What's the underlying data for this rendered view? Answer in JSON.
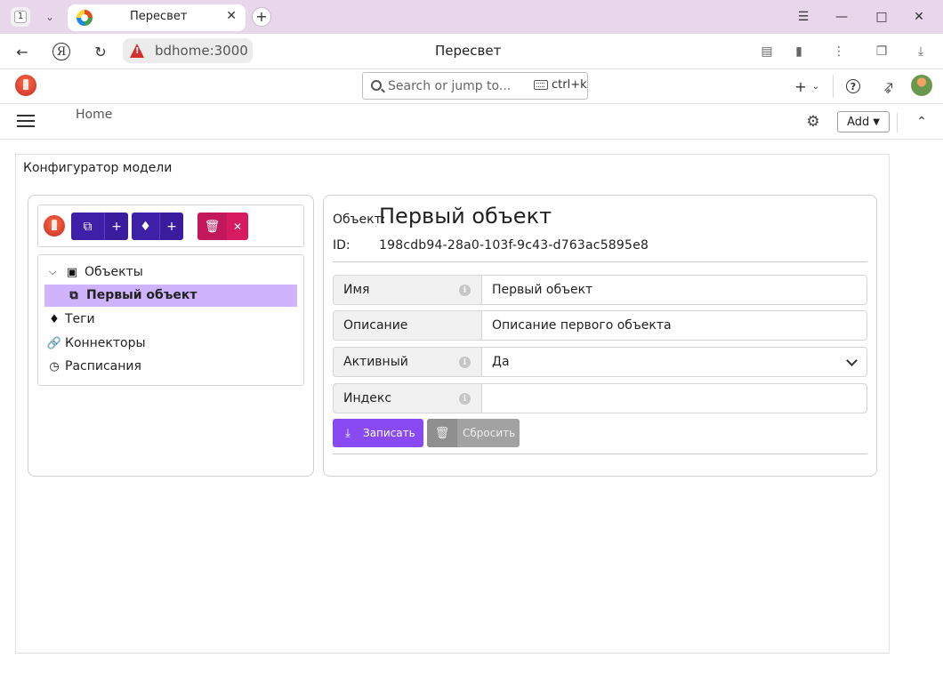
{
  "browser": {
    "tab_count": "1",
    "tab_title": "Пересвет",
    "url_host": "bdhome:3000",
    "page_title": "Пересвет"
  },
  "header": {
    "search_placeholder": "Search or jump to...",
    "search_shortcut": "ctrl+k",
    "breadcrumb": "Home",
    "add_label": "Add"
  },
  "panel": {
    "title": "Конфигуратор модели"
  },
  "tree": {
    "items": [
      {
        "label": "Объекты",
        "icon": "object-group-icon"
      },
      {
        "label": "Первый объект",
        "icon": "object-node-icon",
        "selected": true
      },
      {
        "label": "Теги",
        "icon": "tags-icon"
      },
      {
        "label": "Коннекторы",
        "icon": "link-icon"
      },
      {
        "label": "Расписания",
        "icon": "clock-icon"
      }
    ]
  },
  "object": {
    "caption": "Объект:",
    "name": "Первый объект",
    "id_label": "ID:",
    "id_value": "198cdb94-28a0-103f-9c43-d763ac5895e8"
  },
  "form": {
    "fields": [
      {
        "label": "Имя",
        "value": "Первый объект"
      },
      {
        "label": "Описание",
        "value": "Описание первого объекта"
      },
      {
        "label": "Активный",
        "value": "Да"
      },
      {
        "label": "Индекс",
        "value": ""
      }
    ],
    "save_label": "Записать",
    "reset_label": "Сбросить"
  },
  "colors": {
    "accent_purple": "#8a4af3",
    "indigo": "#3d1fa8",
    "danger": "#c2185b",
    "selected_row": "#cfb3fb"
  }
}
